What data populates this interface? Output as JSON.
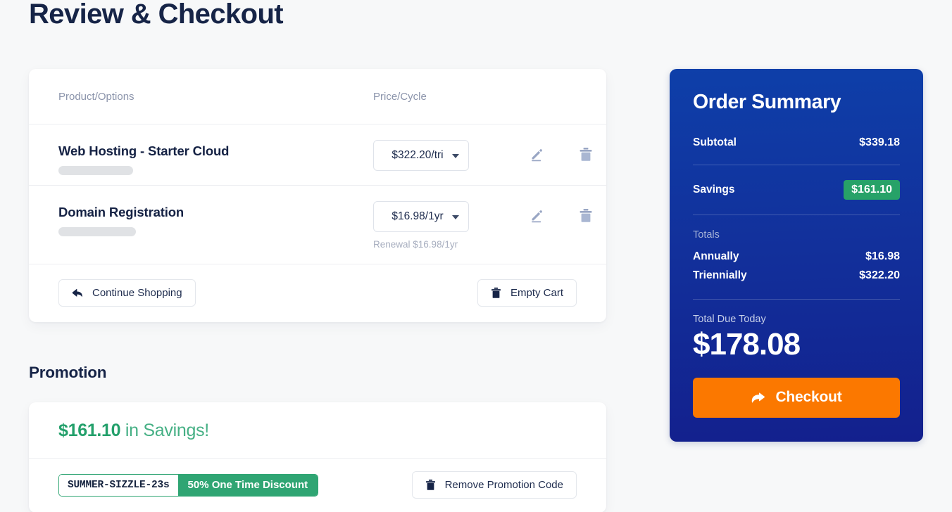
{
  "page": {
    "title": "Review & Checkout"
  },
  "cart": {
    "headers": {
      "product": "Product/Options",
      "price": "Price/Cycle"
    },
    "items": [
      {
        "name": "Web Hosting - Starter Cloud",
        "subtitle_redacted": true,
        "cycle_value": "$322.20/tri",
        "renewal": "",
        "edit_icon": "pencil-icon",
        "delete_icon": "trash-icon"
      },
      {
        "name": "Domain Registration",
        "subtitle_redacted": true,
        "cycle_value": "$16.98/1yr",
        "renewal": "Renewal $16.98/1yr",
        "edit_icon": "pencil-icon",
        "delete_icon": "trash-icon"
      }
    ],
    "actions": {
      "continue_shopping": "Continue Shopping",
      "continue_icon": "back-arrow-icon",
      "empty_cart": "Empty Cart",
      "empty_icon": "trash-icon"
    }
  },
  "promotion": {
    "heading": "Promotion",
    "savings_amount": "$161.10",
    "savings_suffix": " in Savings!",
    "code": "SUMMER-SIZZLE-23s",
    "description": "50% One Time Discount",
    "remove_label": "Remove Promotion Code",
    "remove_icon": "trash-icon"
  },
  "summary": {
    "title": "Order Summary",
    "subtotal_label": "Subtotal",
    "subtotal_value": "$339.18",
    "savings_label": "Savings",
    "savings_value": "$161.10",
    "totals_label": "Totals",
    "totals": [
      {
        "label": "Annually",
        "value": "$16.98"
      },
      {
        "label": "Triennially",
        "value": "$322.20"
      }
    ],
    "due_label": "Total Due Today",
    "due_amount": "$178.08",
    "checkout_label": "Checkout",
    "checkout_icon": "arrow-right-icon"
  },
  "colors": {
    "brand_navy": "#162447",
    "panel_blue_top": "#0e3fa9",
    "panel_blue_bottom": "#13208d",
    "accent_orange": "#fb7800",
    "accent_green": "#27a268",
    "promo_green": "#2fa573",
    "muted_text": "#8b94ab"
  }
}
